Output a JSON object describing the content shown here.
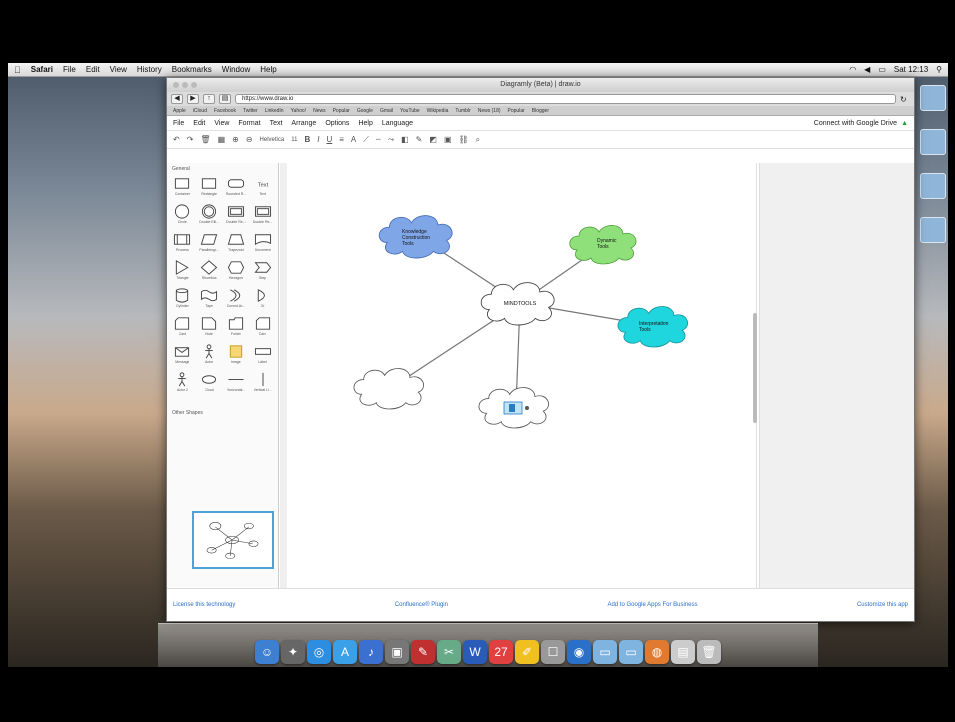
{
  "menubar": {
    "apple": "",
    "items": [
      "Safari",
      "File",
      "Edit",
      "View",
      "History",
      "Bookmarks",
      "Window",
      "Help"
    ],
    "status_right": "Sat 12:13"
  },
  "window": {
    "title": "Diagramly (Beta) | draw.io",
    "url": "https://www.draw.io"
  },
  "bookmarks": [
    "Apple",
    "iCloud",
    "Facebook",
    "Twitter",
    "LinkedIn",
    "Yahoo!",
    "News",
    "Popular",
    "Google",
    "Gmail",
    "YouTube",
    "Wikipedia",
    "Tumblr",
    "News (18)",
    "Popular",
    "Blogger"
  ],
  "app_menu": {
    "items": [
      "File",
      "Edit",
      "View",
      "Format",
      "Text",
      "Arrange",
      "Options",
      "Help",
      "Language"
    ],
    "connect": "Connect with Google Drive"
  },
  "toolbar": {
    "font": "Helvetica",
    "size": "11"
  },
  "sidebar": {
    "general_title": "General",
    "other_title": "Other Shapes",
    "shapes": [
      {
        "label": "Container",
        "icon": "rect-shape-icon"
      },
      {
        "label": "Rectangle",
        "icon": "rect-shape-icon"
      },
      {
        "label": "Rounded R...",
        "icon": "rounded-rect-icon"
      },
      {
        "label": "Text",
        "icon": "text-shape-icon"
      },
      {
        "label": "Circle",
        "icon": "circle-shape-icon"
      },
      {
        "label": "Double Elli...",
        "icon": "double-ellipse-icon"
      },
      {
        "label": "Double Re...",
        "icon": "double-rect-icon"
      },
      {
        "label": "Double Re...",
        "icon": "double-rect-icon"
      },
      {
        "label": "Process",
        "icon": "process-shape-icon"
      },
      {
        "label": "Parallelogr...",
        "icon": "parallelogram-icon"
      },
      {
        "label": "Trapezoid",
        "icon": "trapezoid-icon"
      },
      {
        "label": "Document",
        "icon": "document-shape-icon"
      },
      {
        "label": "Triangle",
        "icon": "triangle-icon"
      },
      {
        "label": "Rhombus",
        "icon": "rhombus-icon"
      },
      {
        "label": "Hexagon",
        "icon": "hexagon-icon"
      },
      {
        "label": "Step",
        "icon": "step-icon"
      },
      {
        "label": "Cylinder",
        "icon": "cylinder-icon"
      },
      {
        "label": "Tape",
        "icon": "tape-icon"
      },
      {
        "label": "Curved Ar...",
        "icon": "curve-icon"
      },
      {
        "label": "Or",
        "icon": "or-shape-icon"
      },
      {
        "label": "Card",
        "icon": "card-icon"
      },
      {
        "label": "Note",
        "icon": "note-icon"
      },
      {
        "label": "Folder",
        "icon": "folder-icon"
      },
      {
        "label": "Card",
        "icon": "card-icon"
      },
      {
        "label": "Message",
        "icon": "message-icon"
      },
      {
        "label": "Actor",
        "icon": "actor-icon"
      },
      {
        "label": "Image",
        "icon": "image-icon"
      },
      {
        "label": "Label",
        "icon": "label-icon"
      },
      {
        "label": "Actor 2",
        "icon": "actor-icon"
      },
      {
        "label": "Cloud",
        "icon": "cloud-icon"
      },
      {
        "label": "Horizontal...",
        "icon": "hline-icon"
      },
      {
        "label": "Vertical Li...",
        "icon": "vline-icon"
      }
    ]
  },
  "diagram": {
    "center": {
      "label": "MINDTOOLS"
    },
    "nodes": [
      {
        "id": "knowledge",
        "label": "Knowledge Construction Tools",
        "color": "#7fa7e8"
      },
      {
        "id": "dynamic",
        "label": "Dynamic Tools",
        "color": "#8fe07a"
      },
      {
        "id": "interpretation",
        "label": "Interpretation Tools",
        "color": "#1fd6de"
      },
      {
        "id": "blank",
        "label": "",
        "color": "#ffffff"
      },
      {
        "id": "image",
        "label": "",
        "color": "#ffffff"
      }
    ]
  },
  "footer": {
    "license": "License this technology",
    "confluence": "Confluence® Plugin",
    "google_apps": "Add to Google Apps For Business",
    "customize": "Customize this app"
  },
  "dock": [
    {
      "name": "finder-icon",
      "color": "#3d7fd0",
      "glyph": "☺"
    },
    {
      "name": "launchpad-icon",
      "color": "#666",
      "glyph": "✦"
    },
    {
      "name": "safari-icon",
      "color": "#2d8de0",
      "glyph": "◎"
    },
    {
      "name": "appstore-icon",
      "color": "#3aa0e8",
      "glyph": "A"
    },
    {
      "name": "itunes-icon",
      "color": "#3b6fd0",
      "glyph": "♪"
    },
    {
      "name": "photos-icon",
      "color": "#777",
      "glyph": "▣"
    },
    {
      "name": "pdf-icon",
      "color": "#c03030",
      "glyph": "✎"
    },
    {
      "name": "tools-icon",
      "color": "#6a8",
      "glyph": "✂"
    },
    {
      "name": "word-icon",
      "color": "#2b5bb8",
      "glyph": "W"
    },
    {
      "name": "calendar-icon",
      "color": "#e04040",
      "glyph": "27"
    },
    {
      "name": "notes-icon",
      "color": "#f0c020",
      "glyph": "✐"
    },
    {
      "name": "preview-icon",
      "color": "#999",
      "glyph": "☐"
    },
    {
      "name": "browser-icon",
      "color": "#2a70c8",
      "glyph": "◉"
    },
    {
      "name": "folder-icon",
      "color": "#7fb3e0",
      "glyph": "▭"
    },
    {
      "name": "downloads-icon",
      "color": "#7fb3e0",
      "glyph": "▭"
    },
    {
      "name": "web-icon",
      "color": "#e07a30",
      "glyph": "◍"
    },
    {
      "name": "docs-icon",
      "color": "#ccc",
      "glyph": "▤"
    },
    {
      "name": "trash-icon",
      "color": "#bbb",
      "glyph": "🗑"
    }
  ]
}
